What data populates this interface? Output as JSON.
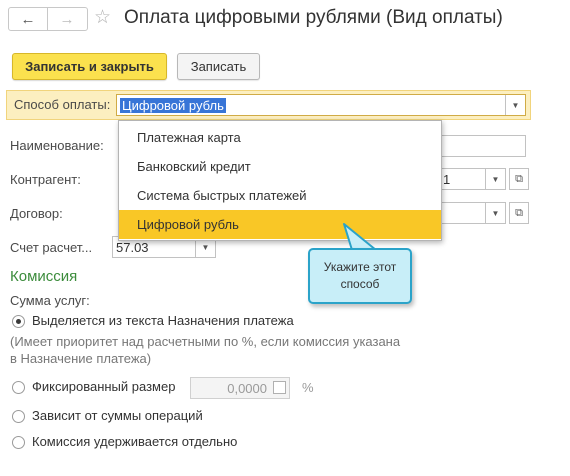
{
  "window": {
    "title": "Оплата цифровыми рублями (Вид оплаты)"
  },
  "nav": {
    "back_icon": "←",
    "forward_icon": "→",
    "favorite_icon": "☆"
  },
  "toolbar": {
    "save_close_label": "Записать и закрыть",
    "save_label": "Записать"
  },
  "form": {
    "payment_method": {
      "label": "Способ оплаты:",
      "value": "Цифровой рубль"
    },
    "name": {
      "label": "Наименование:"
    },
    "counterparty": {
      "label": "Контрагент:",
      "value": "1"
    },
    "contract": {
      "label": "Договор:"
    },
    "account": {
      "label": "Счет расчет...",
      "value": "57.03"
    }
  },
  "dropdown": {
    "items": [
      "Платежная карта",
      "Банковский кредит",
      "Система быстрых платежей",
      "Цифровой рубль"
    ],
    "selected_index": 3
  },
  "callout": {
    "line1": "Укажите этот",
    "line2": "способ"
  },
  "commission": {
    "title": "Комиссия",
    "services_label": "Сумма услуг:",
    "options": [
      {
        "label": "Выделяется из текста Назначения платежа",
        "selected": true
      },
      {
        "label": "Фиксированный размер",
        "selected": false
      },
      {
        "label": "Зависит от суммы операций",
        "selected": false
      },
      {
        "label": "Комиссия удерживается отдельно",
        "selected": false
      }
    ],
    "note_line1": "(Имеет приоритет над расчетными по %, если комиссия указана",
    "note_line2": "в Назначение платежа)",
    "fixed_amount": "0,0000",
    "percent_sign": "%"
  },
  "colors": {
    "primary_button": "#fbe14e",
    "selected_item": "#f9c726",
    "callout_fill": "#c8eef8",
    "callout_border": "#2ba3c9",
    "section_title": "#3c8c3c",
    "highlight_row": "#fcefc0"
  }
}
